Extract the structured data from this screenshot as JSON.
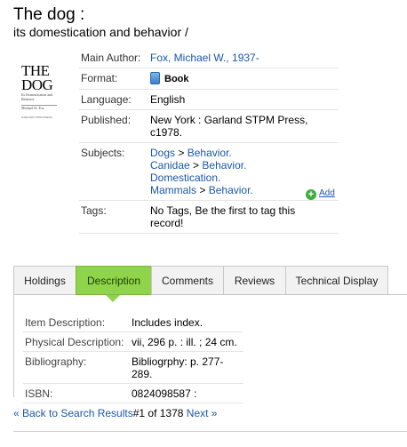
{
  "record": {
    "title": "The dog :",
    "subtitle": "its domestication and behavior /"
  },
  "cover": {
    "title": "THE DOG",
    "subtitle": "Its Domestication and Behavior",
    "author": "Michael W. Fox",
    "publisher": "GARLAND STPM PRESS"
  },
  "details": {
    "main_author_label": "Main Author:",
    "main_author": "Fox, Michael W., 1937-",
    "format_label": "Format:",
    "format": "Book",
    "language_label": "Language:",
    "language": "English",
    "published_label": "Published:",
    "published": "New York : Garland STPM Press, c1978.",
    "subjects_label": "Subjects:",
    "subjects": [
      {
        "parts": [
          "Dogs",
          "Behavior."
        ]
      },
      {
        "parts": [
          "Canidae",
          "Behavior."
        ]
      },
      {
        "parts": [
          "Domestication."
        ]
      },
      {
        "parts": [
          "Mammals",
          "Behavior."
        ]
      }
    ],
    "subject_separator": ">",
    "tags_label": "Tags:",
    "tags": "No Tags, Be the first to tag this record!",
    "add_label": "Add"
  },
  "tabs": [
    {
      "label": "Holdings",
      "active": false
    },
    {
      "label": "Description",
      "active": true
    },
    {
      "label": "Comments",
      "active": false
    },
    {
      "label": "Reviews",
      "active": false
    },
    {
      "label": "Technical Display",
      "active": false
    }
  ],
  "description": {
    "item_description_label": "Item Description:",
    "item_description": "Includes index.",
    "physical_description_label": "Physical Description:",
    "physical_description": "vii, 296 p. : ill. ; 24 cm.",
    "bibliography_label": "Bibliography:",
    "bibliography": "Bibliogrphy: p. 277-289.",
    "isbn_label": "ISBN:",
    "isbn": "0824098587 :"
  },
  "nav": {
    "back_label": "« Back to Search Results",
    "position": "#1 of 1378",
    "next_label": "Next »"
  },
  "colors": {
    "link": "#1b58a9",
    "active_tab": "#8fd44a",
    "add_icon": "#3fae3f"
  }
}
